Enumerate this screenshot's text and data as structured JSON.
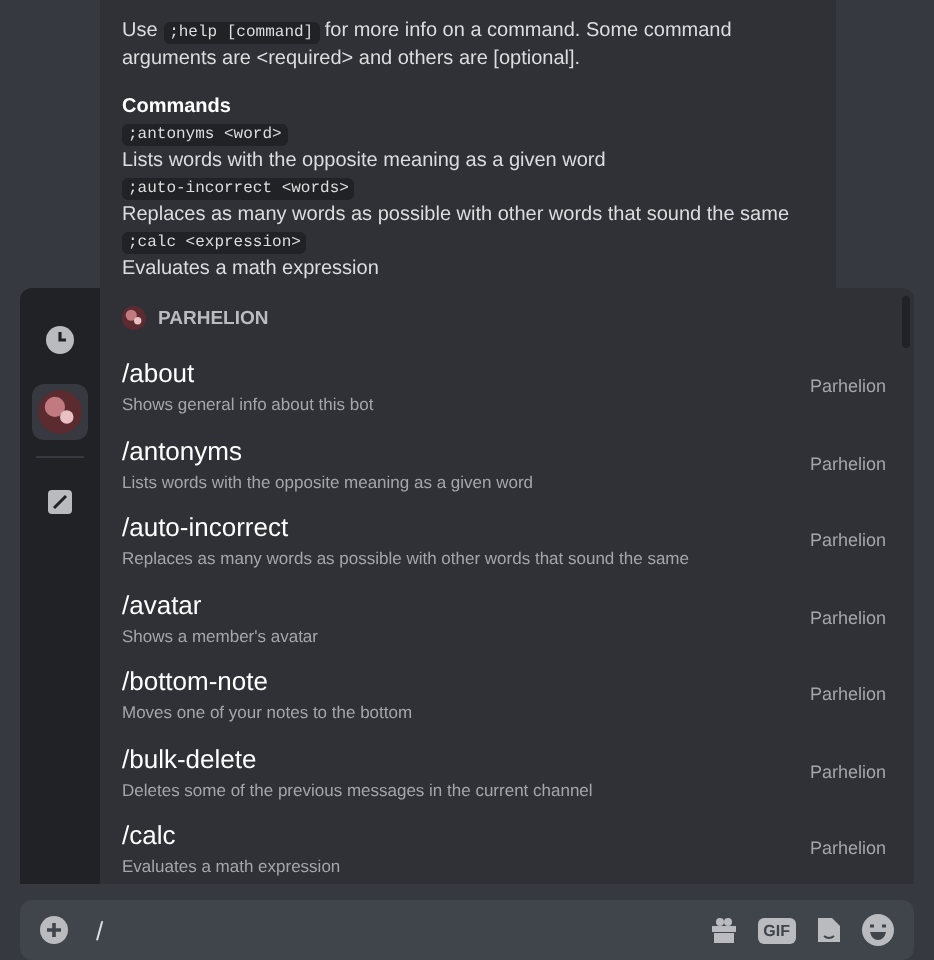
{
  "message": {
    "intro": [
      {
        "kind": "text",
        "text": "Use"
      },
      {
        "kind": "code",
        "text": ";help [command]"
      },
      {
        "kind": "text",
        "text": "for more info on a command. Some command arguments are <required> and others are [optional]."
      }
    ],
    "heading": "Commands",
    "commands": [
      {
        "usage": ";antonyms <word>",
        "description": "Lists words with the opposite meaning as a given word"
      },
      {
        "usage": ";auto-incorrect <words>",
        "description": "Replaces as many words as possible with other words that sound the same"
      },
      {
        "usage": ";calc <expression>",
        "description": "Evaluates a math expression"
      }
    ]
  },
  "autocomplete": {
    "sidebar": [
      {
        "kind": "recent",
        "selected": false
      },
      {
        "kind": "bot",
        "selected": true
      },
      {
        "kind": "builtin",
        "selected": false
      }
    ],
    "section": "PARHELION",
    "commands": [
      {
        "name": "/about",
        "description": "Shows general info about this bot",
        "source": "Parhelion"
      },
      {
        "name": "/antonyms",
        "description": "Lists words with the opposite meaning as a given word",
        "source": "Parhelion"
      },
      {
        "name": "/auto-incorrect",
        "description": "Replaces as many words as possible with other words that sound the same",
        "source": "Parhelion"
      },
      {
        "name": "/avatar",
        "description": "Shows a member's avatar",
        "source": "Parhelion"
      },
      {
        "name": "/bottom-note",
        "description": "Moves one of your notes to the bottom",
        "source": "Parhelion"
      },
      {
        "name": "/bulk-delete",
        "description": "Deletes some of the previous messages in the current channel",
        "source": "Parhelion"
      },
      {
        "name": "/calc",
        "description": "Evaluates a math expression",
        "source": "Parhelion"
      }
    ]
  },
  "composer": {
    "value": "/",
    "gif_label": "GIF"
  }
}
